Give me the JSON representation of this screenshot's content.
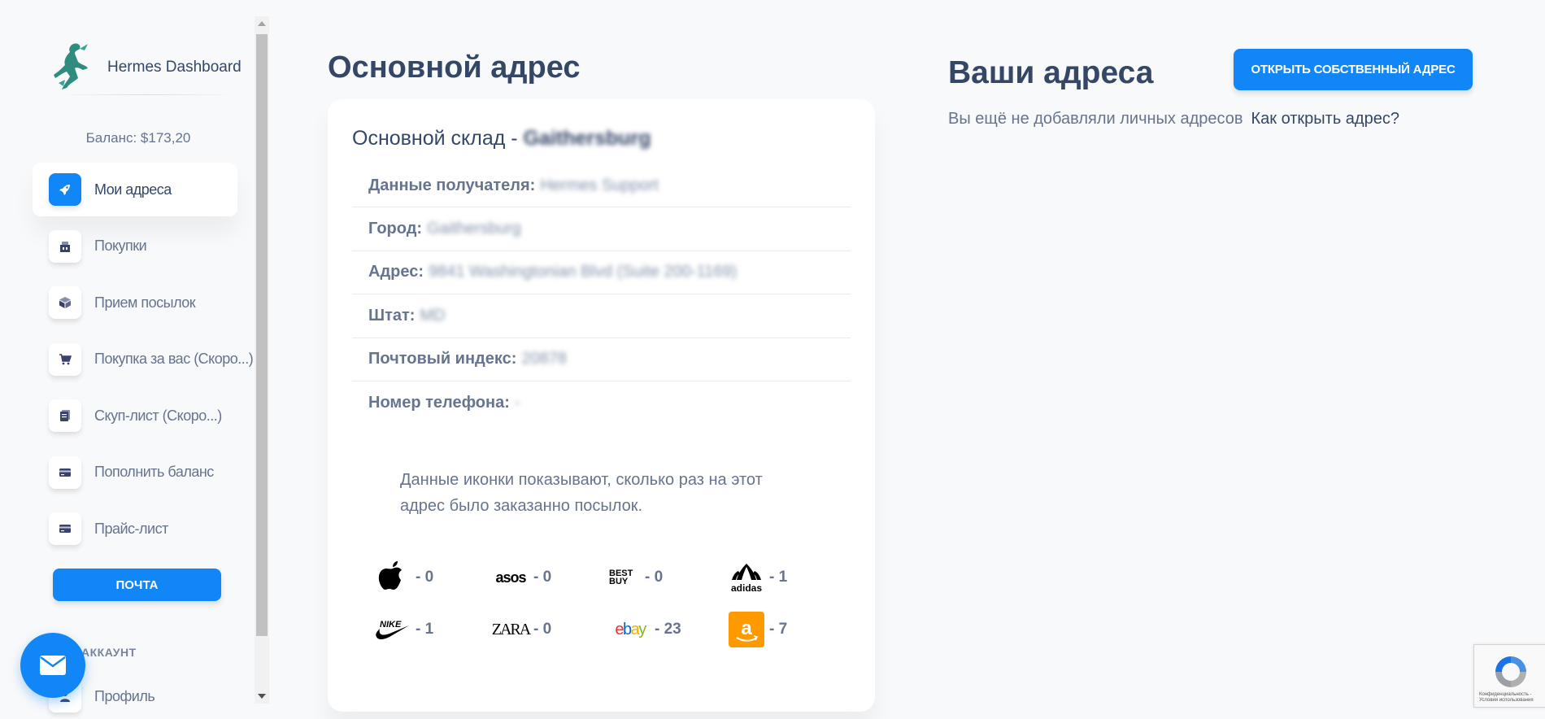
{
  "sidebar": {
    "brand_name": "Hermes Dashboard",
    "balance": "Баланс: $173,20",
    "items": [
      {
        "label": "Мои адреса",
        "icon": "rocket-icon",
        "active": true
      },
      {
        "label": "Покупки",
        "icon": "shop-icon"
      },
      {
        "label": "Прием посылок",
        "icon": "box-icon"
      },
      {
        "label": "Покупка за вас (Скоро...)",
        "icon": "cart-icon"
      },
      {
        "label": "Скуп-лист (Скоро...)",
        "icon": "document-icon"
      },
      {
        "label": "Пополнить баланс",
        "icon": "credit-card-icon"
      },
      {
        "label": "Прайс-лист",
        "icon": "credit-card-icon"
      }
    ],
    "mail_button": "ПОЧТА",
    "account_heading": "АККАУНТ",
    "profile_label": "Профиль"
  },
  "main": {
    "title": "Основной адрес",
    "card": {
      "title_prefix": "Основной склад - ",
      "title_value": "Gaithersburg",
      "rows": [
        {
          "label": "Данные получателя:",
          "value": "Hermes Support"
        },
        {
          "label": "Город:",
          "value": "Gaithersburg"
        },
        {
          "label": "Адрес:",
          "value": "9841 Washingtonian Blvd (Suite 200-1169)"
        },
        {
          "label": "Штат:",
          "value": "MD"
        },
        {
          "label": "Почтовый индекс:",
          "value": "20878"
        },
        {
          "label": "Номер телефона:",
          "value": "-"
        }
      ],
      "info_text": "Данные иконки показывают, сколько раз на этот адрес было заказанно посылок.",
      "brands": [
        {
          "name": "apple",
          "icon": "apple-logo-icon",
          "count": "- 0"
        },
        {
          "name": "asos",
          "icon": "asos-logo-icon",
          "count": "- 0"
        },
        {
          "name": "bestbuy",
          "icon": "bestbuy-logo-icon",
          "count": "- 0"
        },
        {
          "name": "adidas",
          "icon": "adidas-logo-icon",
          "count": "- 1"
        },
        {
          "name": "nike",
          "icon": "nike-logo-icon",
          "count": "- 1"
        },
        {
          "name": "zara",
          "icon": "zara-logo-icon",
          "count": "- 0"
        },
        {
          "name": "ebay",
          "icon": "ebay-logo-icon",
          "count": "- 23"
        },
        {
          "name": "amazon",
          "icon": "amazon-logo-icon",
          "count": "- 7"
        }
      ]
    }
  },
  "addresses": {
    "title": "Ваши адреса",
    "open_button": "ОТКРЫТЬ СОБСТВЕННЫЙ АДРЕС",
    "empty_text": "Вы ещё не добавляли личных адресов",
    "how_link": "Как открыть адрес?"
  },
  "logo_text": {
    "asos": "asos",
    "bestbuy": "BEST BUY",
    "adidas": "adidas",
    "zara": "ZARA",
    "ebay_e": "e",
    "ebay_b": "b",
    "ebay_a": "a",
    "ebay_y": "y",
    "recaptcha": "Конфиденциальность - Условия использования"
  },
  "colors": {
    "primary": "#1086f7",
    "heading": "#344767",
    "text": "#67748e",
    "background": "#f8f9fa"
  }
}
